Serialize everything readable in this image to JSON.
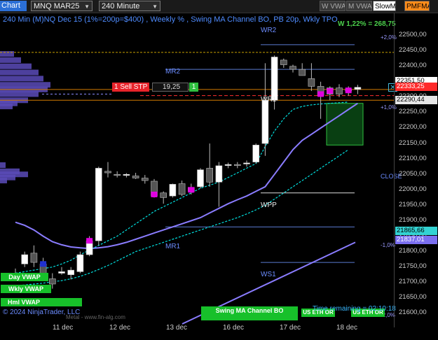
{
  "toolbar": {
    "chart_menu": "Chart",
    "instrument": "MNQ MAR25",
    "interval": "240 Minute",
    "buttons": [
      "W VWAP",
      "M VWAP",
      "SlowMA",
      "PMFMA"
    ]
  },
  "chart": {
    "title": "240 Min (M)NQ Dec 15 (1%=200p=$400) , Weekly % , Swing MA Channel BO, PB 20p, Wkly TPO",
    "weekly_pct": "W 1,22% = 268,75",
    "levels": {
      "wr2": "WR2",
      "mr2": "MR2",
      "wr1": "WR1",
      "wpp": "WPP",
      "mr1": "MR1",
      "ws1": "WS1",
      "close": "CLOSE"
    },
    "pct_labels": {
      "p2": "+2,0%",
      "p1": "+1,0%",
      "m1": "-1,0%",
      "m2": "-2,0%"
    },
    "order": {
      "label": "1  Sell STP",
      "qty": "19,25",
      "marker": "1",
      "close_x": "✕"
    },
    "vwap_pills": {
      "day": "Day VWAP",
      "week": "Wkly VWAP",
      "hml": "Hml VWAP"
    },
    "bottom_pills": {
      "channel": "Swing MA Channel BO",
      "eth1": "US ETH OR",
      "eth2": "US ETH OR"
    },
    "time_remaining": "Time remaining = 02:10:18",
    "copyright": "© 2024 NinjaTrader, LLC",
    "website": "Metal - www.fin-alg.com"
  },
  "price_axis": {
    "ticks": [
      "22500,00",
      "22450,00",
      "22400,00",
      "22350,00",
      "22300,00",
      "22250,00",
      "22200,00",
      "22150,00",
      "22100,00",
      "22050,00",
      "22000,00",
      "21950,00",
      "21900,00",
      "21850,00",
      "21800,00",
      "21750,00",
      "21700,00",
      "21650,00",
      "21600,00"
    ],
    "labels": {
      "last": "22351,50",
      "stop": "22333,25",
      "level": "22290,44",
      "ma_upper": "21865,66",
      "ma_lower": "21837,01"
    }
  },
  "time_axis": {
    "dates": [
      "11 dec",
      "12 dec",
      "13 dec",
      "16 dec",
      "17 dec",
      "18 dec"
    ]
  },
  "colors": {
    "bull": "#ffffff",
    "bear": "#555555",
    "signal": "#e000e0",
    "ma": "#8a7cff",
    "band": "#00e0e0"
  },
  "chart_data": {
    "type": "candlestick",
    "ylim": [
      21590,
      22530
    ],
    "candles": [
      {
        "o": 21740,
        "h": 21755,
        "l": 21715,
        "c": 21732
      },
      {
        "o": 21770,
        "h": 21810,
        "l": 21760,
        "c": 21800
      },
      {
        "o": 21805,
        "h": 21830,
        "l": 21760,
        "c": 21775
      },
      {
        "o": 21770,
        "h": 21790,
        "l": 21715,
        "c": 21733
      },
      {
        "o": 21722,
        "h": 21740,
        "l": 21690,
        "c": 21705
      },
      {
        "o": 21740,
        "h": 21760,
        "l": 21735,
        "c": 21745
      },
      {
        "o": 21735,
        "h": 21760,
        "l": 21720,
        "c": 21750
      },
      {
        "o": 21745,
        "h": 21810,
        "l": 21740,
        "c": 21800
      },
      {
        "o": 21800,
        "h": 21860,
        "l": 21795,
        "c": 21845
      },
      {
        "o": 21845,
        "h": 22085,
        "l": 21830,
        "c": 22080
      },
      {
        "o": 22070,
        "h": 22100,
        "l": 22050,
        "c": 22065
      },
      {
        "o": 22060,
        "h": 22070,
        "l": 22050,
        "c": 22057
      },
      {
        "o": 22057,
        "h": 22064,
        "l": 22050,
        "c": 22060
      },
      {
        "o": 22055,
        "h": 22065,
        "l": 22045,
        "c": 22048
      },
      {
        "o": 22048,
        "h": 22058,
        "l": 22030,
        "c": 22040
      },
      {
        "o": 22038,
        "h": 22045,
        "l": 21985,
        "c": 21990
      },
      {
        "o": 22000,
        "h": 22005,
        "l": 21965,
        "c": 21985
      },
      {
        "o": 21990,
        "h": 22030,
        "l": 21985,
        "c": 22028
      },
      {
        "o": 22030,
        "h": 22040,
        "l": 21990,
        "c": 21995
      },
      {
        "o": 22005,
        "h": 22030,
        "l": 21995,
        "c": 22018
      },
      {
        "o": 22020,
        "h": 22080,
        "l": 22015,
        "c": 22075
      },
      {
        "o": 22080,
        "h": 22160,
        "l": 22020,
        "c": 22035
      },
      {
        "o": 22035,
        "h": 22100,
        "l": 21955,
        "c": 22088
      },
      {
        "o": 22090,
        "h": 22098,
        "l": 22080,
        "c": 22092
      },
      {
        "o": 22092,
        "h": 22100,
        "l": 22080,
        "c": 22090
      },
      {
        "o": 22095,
        "h": 22105,
        "l": 22085,
        "c": 22097
      },
      {
        "o": 22100,
        "h": 22160,
        "l": 22095,
        "c": 22155
      },
      {
        "o": 22160,
        "h": 22420,
        "l": 22120,
        "c": 22300
      },
      {
        "o": 22300,
        "h": 22445,
        "l": 22270,
        "c": 22440
      },
      {
        "o": 22430,
        "h": 22435,
        "l": 22405,
        "c": 22415
      },
      {
        "o": 22410,
        "h": 22415,
        "l": 22390,
        "c": 22400
      },
      {
        "o": 22400,
        "h": 22420,
        "l": 22385,
        "c": 22380
      },
      {
        "o": 22370,
        "h": 22420,
        "l": 22330,
        "c": 22345
      },
      {
        "o": 22345,
        "h": 22360,
        "l": 22240,
        "c": 22315
      },
      {
        "o": 22320,
        "h": 22345,
        "l": 22300,
        "c": 22340
      },
      {
        "o": 22340,
        "h": 22352,
        "l": 22310,
        "c": 22320
      },
      {
        "o": 22330,
        "h": 22345,
        "l": 22315,
        "c": 22335
      },
      {
        "o": 22335,
        "h": 22350,
        "l": 22320,
        "c": 22342
      }
    ],
    "slow_ma": [
      21905,
      21895,
      21880,
      21860,
      21842,
      21832,
      21825,
      21822,
      21820,
      21822,
      21826,
      21832,
      21840,
      21850,
      21860,
      21870,
      21880,
      21890,
      21900,
      21910,
      21920,
      21935,
      21950,
      21965,
      21978,
      21990,
      22005,
      22020,
      22060,
      22100,
      22140,
      22170,
      22190,
      22210,
      22230,
      22250,
      22270,
      22290
    ],
    "channel_upper": [
      21740,
      21745,
      21750,
      21755,
      21760,
      21770,
      21782,
      21800,
      21815,
      21830,
      21845,
      21860,
      21880,
      21900,
      21920,
      21940,
      21955,
      21970,
      21985,
      22000,
      22015,
      22025,
      22035,
      22050,
      22065,
      22080,
      22095,
      22150,
      22200,
      22240,
      22270,
      22280,
      22285,
      22288,
      22290,
      22292,
      22294,
      22296
    ],
    "channel_lower": [
      21700,
      21702,
      21705,
      21708,
      21712,
      21716,
      21722,
      21730,
      21740,
      21752,
      21765,
      21780,
      21795,
      21810,
      21820,
      21830,
      21840,
      21850,
      21860,
      21870,
      21880,
      21890,
      21900,
      21910,
      21920,
      21932,
      21945,
      21960,
      21980,
      22000,
      22020,
      22040,
      22060,
      22080,
      22100,
      22120,
      22140,
      21860
    ]
  }
}
